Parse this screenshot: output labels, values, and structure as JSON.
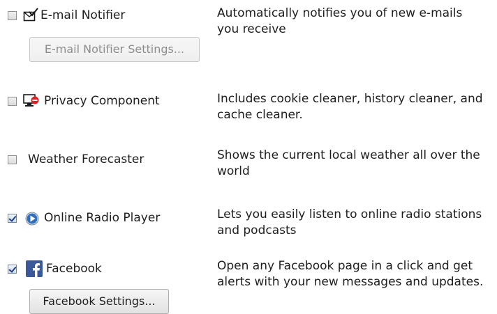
{
  "components": [
    {
      "id": "email",
      "name": "E-mail Notifier",
      "description": "Automatically notifies you of new e-mails\nyou receive",
      "checked": false,
      "icon": "envelope-check-icon",
      "button_label": "E-mail Notifier Settings...",
      "button_enabled": false
    },
    {
      "id": "privacy",
      "name": "Privacy Component",
      "description": "Includes cookie cleaner, history cleaner, and\ncache cleaner.",
      "checked": false,
      "icon": "privacy-screen-icon"
    },
    {
      "id": "weather",
      "name": "Weather Forecaster",
      "description": "Shows the current local weather all over the\nworld",
      "checked": false
    },
    {
      "id": "radio",
      "name": "Online Radio Player",
      "description": "Lets you easily listen to online radio stations\nand podcasts",
      "checked": true,
      "icon": "play-circle-icon"
    },
    {
      "id": "facebook",
      "name": "Facebook",
      "description": "Open any Facebook page in a click and get\nalerts with your new messages and updates.",
      "checked": true,
      "icon": "facebook-icon",
      "button_label": "Facebook Settings...",
      "button_enabled": true
    }
  ],
  "colors": {
    "facebook_blue": "#3b5998",
    "privacy_red": "#e02020",
    "radio_blue": "#2f6fc0"
  }
}
